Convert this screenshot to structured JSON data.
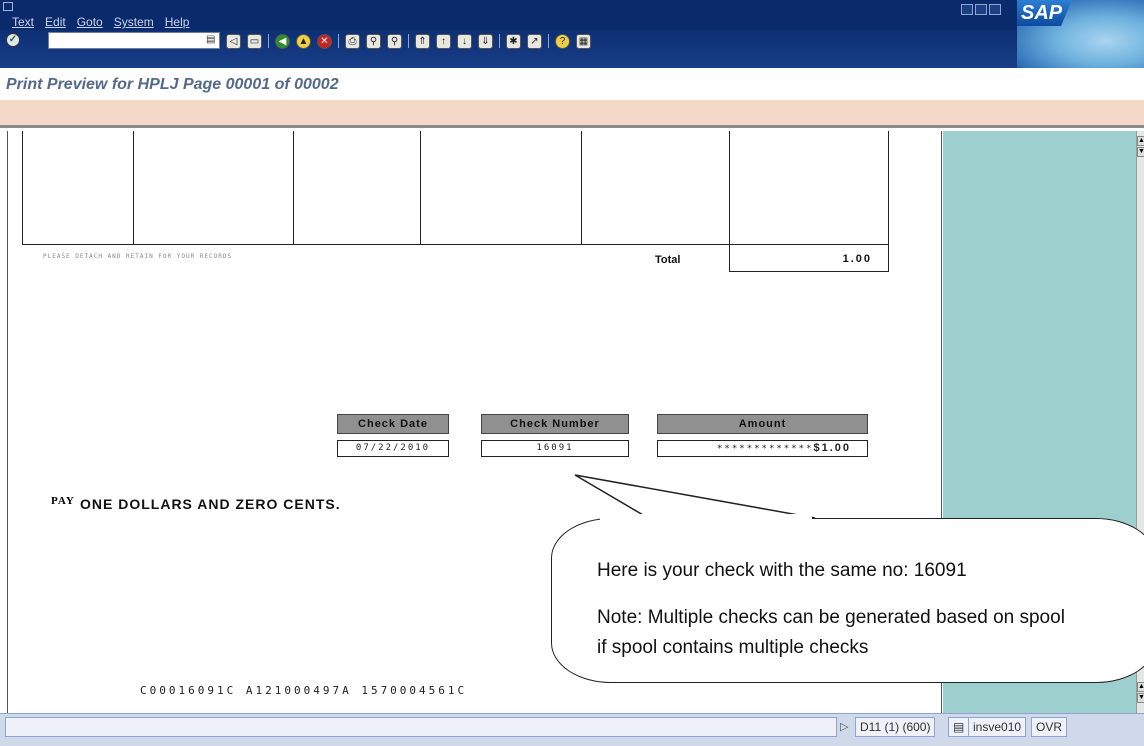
{
  "menu": [
    "Text",
    "Edit",
    "Goto",
    "System",
    "Help"
  ],
  "logo": "SAP",
  "title": "Print Preview for HPLJ Page 00001 of 00002",
  "document": {
    "detach_note": "PLEASE DETACH AND RETAIN FOR YOUR RECORDS",
    "total_label": "Total",
    "total_value": "1.00",
    "headers": {
      "check_date": "Check Date",
      "check_number": "Check Number",
      "amount": "Amount"
    },
    "values": {
      "check_date": "07/22/2010",
      "check_number": "16091",
      "amount_stars": "*************",
      "amount": "$1.00"
    },
    "pay_label": "PAY",
    "pay_text": "ONE DOLLARS AND ZERO CENTS.",
    "micr_line": "C00016091C A121000497A 1570004561C"
  },
  "callout": {
    "line1": "Here is your check with the same no: 16091",
    "line2": "Note: Multiple checks can be generated based on spool if spool contains multiple checks"
  },
  "status": {
    "system": "D11 (1) (600)",
    "server": "insve010",
    "mode": "OVR"
  },
  "colors": {
    "header_blue": "#0a2a6b",
    "title_text": "#546a8a",
    "app_bar": "#f4d8c8",
    "side_panel": "#9dcfce"
  }
}
